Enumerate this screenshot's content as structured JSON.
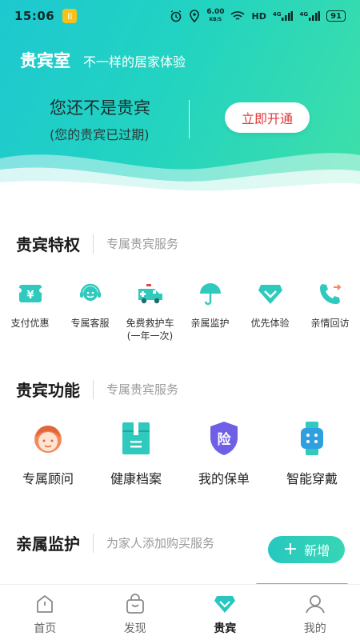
{
  "status_bar": {
    "time": "15:06",
    "app_badge": "Ii",
    "speed_value": "6.00",
    "speed_unit": "KB/S",
    "hd_label": "HD",
    "net1": "4G",
    "net2": "4G",
    "battery": "91"
  },
  "header": {
    "title": "贵宾室",
    "slogan": "不一样的居家体验",
    "vip_title": "您还不是贵宾",
    "vip_subtitle": "(您的贵宾已过期)",
    "activate_label": "立即开通"
  },
  "privileges": {
    "title": "贵宾特权",
    "subtitle": "专属贵宾服务",
    "items": [
      {
        "label": "支付优惠",
        "icon": "payment-discount-icon"
      },
      {
        "label": "专属客服",
        "icon": "customer-service-icon"
      },
      {
        "label": "免费救护车",
        "label2": "(一年一次)",
        "icon": "ambulance-icon"
      },
      {
        "label": "亲属监护",
        "icon": "umbrella-icon"
      },
      {
        "label": "优先体验",
        "icon": "diamond-icon"
      },
      {
        "label": "亲情回访",
        "icon": "phone-callback-icon"
      }
    ]
  },
  "functions": {
    "title": "贵宾功能",
    "subtitle": "专属贵宾服务",
    "items": [
      {
        "label": "专属顾问",
        "icon": "advisor-icon"
      },
      {
        "label": "健康档案",
        "icon": "health-file-icon"
      },
      {
        "label": "我的保单",
        "icon": "insurance-shield-icon",
        "badge": "险"
      },
      {
        "label": "智能穿戴",
        "icon": "smartwatch-icon"
      }
    ]
  },
  "guardian": {
    "title": "亲属监护",
    "subtitle": "为家人添加购买服务",
    "add_label": "新增"
  },
  "nav": {
    "items": [
      {
        "label": "首页",
        "icon": "home-icon"
      },
      {
        "label": "发现",
        "icon": "shopping-bag-icon"
      },
      {
        "label": "贵宾",
        "icon": "vip-diamond-icon"
      },
      {
        "label": "我的",
        "icon": "user-icon"
      }
    ],
    "active": "贵宾"
  },
  "colors": {
    "accent": "#27c7c0",
    "accent_light": "#3fe0a8",
    "activate_text": "#e03a3a",
    "shield_purple": "#6f5fe6",
    "advisor_orange": "#f28a5a"
  }
}
